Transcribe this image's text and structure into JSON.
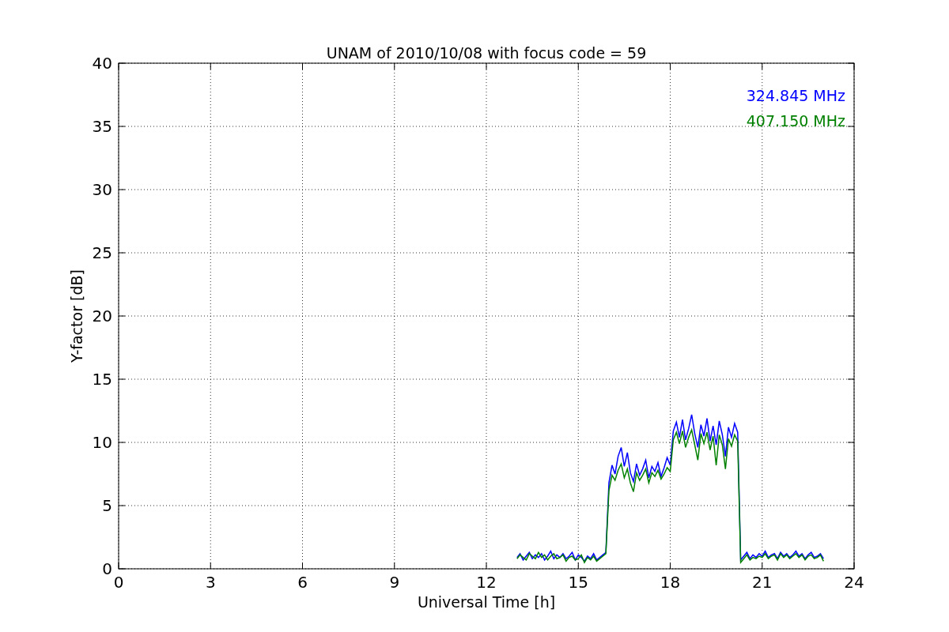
{
  "chart_data": {
    "type": "line",
    "title": "UNAM of 2010/10/08 with focus code = 59",
    "xlabel": "Universal Time [h]",
    "ylabel": "Y-factor [dB]",
    "x": [
      13.0,
      13.1,
      13.2,
      13.3,
      13.4,
      13.5,
      13.6,
      13.7,
      13.8,
      13.9,
      14.0,
      14.1,
      14.2,
      14.3,
      14.4,
      14.5,
      14.6,
      14.7,
      14.8,
      14.9,
      15.0,
      15.1,
      15.2,
      15.3,
      15.4,
      15.5,
      15.6,
      15.7,
      15.8,
      15.9,
      16.0,
      16.1,
      16.2,
      16.3,
      16.4,
      16.5,
      16.6,
      16.7,
      16.8,
      16.9,
      17.0,
      17.1,
      17.2,
      17.3,
      17.4,
      17.5,
      17.6,
      17.7,
      17.8,
      17.9,
      18.0,
      18.1,
      18.2,
      18.3,
      18.4,
      18.5,
      18.6,
      18.7,
      18.8,
      18.9,
      19.0,
      19.1,
      19.2,
      19.3,
      19.4,
      19.5,
      19.6,
      19.7,
      19.8,
      19.9,
      20.0,
      20.1,
      20.2,
      20.3,
      20.4,
      20.5,
      20.6,
      20.7,
      20.8,
      20.9,
      21.0,
      21.1,
      21.2,
      21.3,
      21.4,
      21.5,
      21.6,
      21.7,
      21.8,
      21.9,
      22.0,
      22.1,
      22.2,
      22.3,
      22.4,
      22.5,
      22.6,
      22.7,
      22.8,
      22.9,
      23.0
    ],
    "series": [
      {
        "name": "324.845 MHz",
        "color": "#0000ff",
        "values": [
          0.9,
          1.2,
          0.7,
          1.0,
          1.3,
          0.8,
          1.1,
          0.9,
          1.2,
          0.7,
          1.0,
          1.4,
          0.8,
          1.1,
          0.9,
          1.2,
          0.8,
          1.0,
          1.3,
          0.7,
          1.1,
          0.9,
          0.6,
          1.0,
          0.8,
          1.2,
          0.7,
          0.9,
          1.1,
          1.3,
          6.8,
          8.2,
          7.5,
          8.9,
          9.6,
          8.1,
          9.2,
          7.6,
          6.9,
          8.3,
          7.4,
          7.9,
          8.6,
          7.2,
          8.1,
          7.7,
          8.4,
          7.3,
          8.0,
          8.8,
          8.2,
          10.9,
          11.6,
          10.4,
          11.8,
          10.2,
          11.1,
          12.2,
          10.7,
          9.6,
          11.4,
          10.5,
          11.9,
          10.1,
          11.3,
          9.8,
          11.7,
          10.6,
          8.9,
          11.2,
          10.4,
          11.5,
          10.8,
          0.7,
          1.0,
          1.3,
          0.8,
          1.1,
          0.9,
          1.2,
          1.0,
          1.4,
          0.9,
          1.1,
          1.2,
          0.8,
          1.3,
          1.0,
          1.2,
          0.9,
          1.1,
          1.4,
          1.0,
          1.2,
          0.8,
          1.1,
          1.3,
          0.9,
          1.0,
          1.2,
          0.8
        ]
      },
      {
        "name": "407.150 MHz",
        "color": "#008000",
        "values": [
          0.8,
          1.1,
          0.9,
          0.7,
          1.2,
          1.0,
          0.8,
          1.3,
          0.9,
          1.1,
          0.7,
          1.0,
          1.2,
          0.8,
          0.9,
          1.1,
          0.6,
          0.9,
          1.0,
          0.7,
          0.8,
          1.1,
          0.5,
          0.9,
          0.7,
          1.0,
          0.6,
          0.8,
          1.0,
          1.2,
          6.2,
          7.4,
          7.0,
          7.8,
          8.3,
          7.2,
          7.9,
          6.8,
          6.1,
          7.6,
          7.0,
          7.4,
          7.9,
          6.8,
          7.6,
          7.3,
          7.8,
          7.1,
          7.5,
          8.0,
          7.7,
          10.2,
          10.8,
          9.9,
          10.9,
          9.6,
          10.4,
          11.0,
          9.8,
          8.6,
          10.7,
          9.9,
          10.8,
          9.4,
          10.5,
          8.2,
          10.6,
          9.8,
          7.9,
          10.3,
          9.7,
          10.6,
          10.1,
          0.5,
          0.8,
          1.1,
          0.7,
          0.9,
          0.8,
          1.0,
          0.9,
          1.2,
          0.8,
          1.0,
          1.1,
          0.7,
          1.2,
          0.9,
          1.1,
          0.8,
          1.0,
          1.2,
          0.9,
          1.1,
          0.7,
          1.0,
          1.1,
          0.8,
          0.9,
          1.1,
          0.6
        ]
      }
    ],
    "grid": true,
    "xlim": [
      0,
      24
    ],
    "ylim": [
      0,
      40
    ],
    "xticks": [
      0,
      3,
      6,
      9,
      12,
      15,
      18,
      21,
      24
    ],
    "yticks": [
      0,
      5,
      10,
      15,
      20,
      25,
      30,
      35,
      40
    ]
  }
}
